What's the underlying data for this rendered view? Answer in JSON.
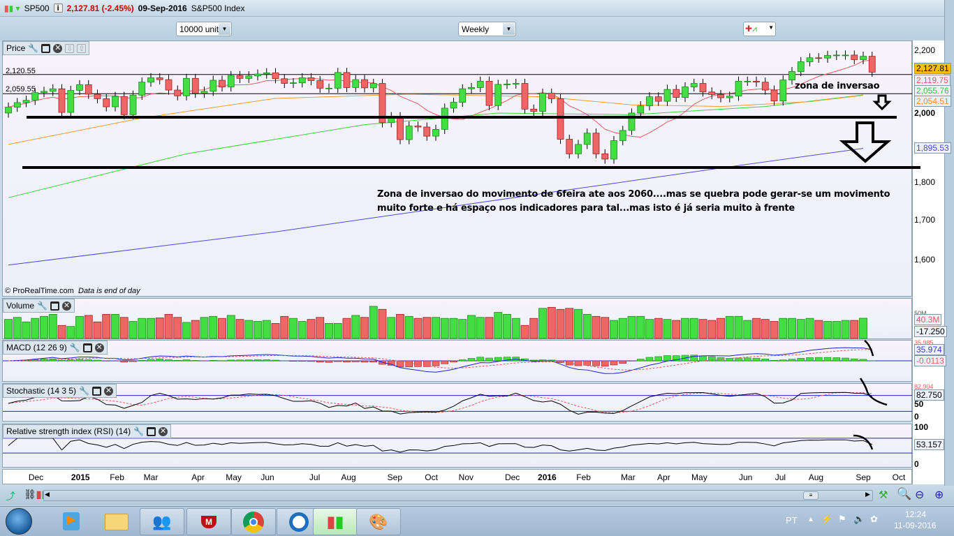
{
  "titlebar": {
    "symbol": "SP500",
    "price_change": "2,127.81 (-2.45%)",
    "date": "09-Sep-2016",
    "name": "S&P500 Index"
  },
  "toolbar": {
    "units": "10000 units",
    "period": "Weekly"
  },
  "price_panel": {
    "title": "Price",
    "hline1": "2,120.55",
    "hline2": "2,059.55",
    "footer": "© ProRealTime.com",
    "footer_note": "Data is end of day",
    "axis": [
      "2,200",
      "2,000",
      "1,800",
      "1,700",
      "1,600"
    ],
    "values": {
      "last": "2,127.81",
      "ma_red": "2,119.75",
      "ma_green": "2,055.76",
      "ma_orange": "2,054.51",
      "ma_blue": "1,895.53"
    }
  },
  "volume_panel": {
    "title": "Volume",
    "axis_top": "50M",
    "last": "40.3M",
    "value2": "-17.250"
  },
  "macd_panel": {
    "title": "MACD (12 26 9)",
    "v_hidden": "35.985",
    "v1": "35.974",
    "v2": "-0.0113"
  },
  "stoch_panel": {
    "title": "Stochastic (14 3 5)",
    "v_hidden": "82.904",
    "v1": "82.750",
    "axis": [
      "50",
      "0"
    ]
  },
  "rsi_panel": {
    "title": "Relative strength index (RSI) (14)",
    "v1": "53.157",
    "axis": [
      "100",
      "0"
    ]
  },
  "annotations": {
    "zone": "zona de inversao",
    "text1": "Zona de inversao do movimento de 6feira ate aos 2060....mas se quebra pode gerar-se um movimento",
    "text2": "muito forte e há espaço nos indicadores para tal...mas isto é já seria muito à frente"
  },
  "colors": {
    "up": "#44dd44",
    "down": "#ee6666",
    "ma_red": "#e06060",
    "ma_orange": "#f0a030",
    "ma_green": "#40d040",
    "ma_blue": "#4a4ae0",
    "last_box": "#f6c000"
  },
  "taskbar": {
    "lang": "PT",
    "time": "12:24",
    "date": "11-09-2016"
  },
  "chart_data": {
    "type": "candlestick",
    "scale": "log",
    "ylim": [
      1550,
      2230
    ],
    "first_open": 2000,
    "close": [
      2018,
      2032,
      2039,
      2063,
      2067,
      2075,
      2002,
      2070,
      2088,
      2058,
      2044,
      2019,
      2051,
      1995,
      2055,
      2096,
      2110,
      2104,
      2071,
      2053,
      2108,
      2061,
      2067,
      2102,
      2081,
      2117,
      2108,
      2116,
      2122,
      2126,
      2107,
      2092,
      2094,
      2110,
      2101,
      2077,
      2077,
      2127,
      2079,
      2104,
      2078,
      2092,
      1971,
      1989,
      1921,
      1961,
      1958,
      1931,
      1951,
      2015,
      2033,
      2075,
      2079,
      2099,
      2023,
      2089,
      2090,
      2092,
      2012,
      2005,
      2061,
      2044,
      1922,
      1880,
      1907,
      1940,
      1880,
      1865,
      1918,
      1948,
      2000,
      2022,
      2050,
      2036,
      2073,
      2048,
      2081,
      2092,
      2065,
      2057,
      2047,
      2052,
      2099,
      2099,
      2096,
      2071,
      2037,
      2103,
      2130,
      2162,
      2175,
      2174,
      2183,
      2184,
      2184,
      2169,
      2180,
      2128
    ],
    "volume": [
      38,
      42,
      33,
      40,
      44,
      48,
      26,
      24,
      44,
      46,
      33,
      48,
      48,
      42,
      34,
      40,
      40,
      41,
      48,
      42,
      32,
      36,
      42,
      44,
      40,
      46,
      38,
      36,
      34,
      36,
      30,
      44,
      40,
      34,
      38,
      42,
      30,
      30,
      40,
      46,
      42,
      64,
      58,
      42,
      48,
      44,
      40,
      42,
      42,
      40,
      40,
      38,
      46,
      42,
      42,
      52,
      48,
      40,
      26,
      40,
      60,
      62,
      58,
      60,
      58,
      48,
      44,
      42,
      36,
      40,
      44,
      44,
      38,
      40,
      38,
      36,
      40,
      40,
      38,
      36,
      40,
      44,
      44,
      36,
      40,
      38,
      34,
      40,
      40,
      38,
      40,
      36,
      34,
      34,
      36,
      36,
      40.3
    ],
    "ma_orange": [
      [
        0,
        1907
      ],
      [
        15,
        1985
      ],
      [
        30,
        2045
      ],
      [
        45,
        2058
      ],
      [
        60,
        2050
      ],
      [
        70,
        2025
      ],
      [
        80,
        2020
      ],
      [
        90,
        2035
      ],
      [
        96,
        2054.51
      ]
    ],
    "ma_green": [
      [
        0,
        1759
      ],
      [
        20,
        1880
      ],
      [
        40,
        1965
      ],
      [
        55,
        2000
      ],
      [
        70,
        1995
      ],
      [
        85,
        2020
      ],
      [
        96,
        2055.76
      ]
    ],
    "ma_blue": [
      [
        0,
        1588
      ],
      [
        30,
        1670
      ],
      [
        60,
        1770
      ],
      [
        80,
        1840
      ],
      [
        96,
        1895.53
      ]
    ],
    "hlines": [
      2120.55,
      2059.55
    ],
    "months": [
      [
        "Dec",
        3.1
      ],
      [
        "2015",
        8.1
      ],
      [
        "Feb",
        12.2
      ],
      [
        "Mar",
        16
      ],
      [
        "Apr",
        21.3
      ],
      [
        "May",
        25.3
      ],
      [
        "Jun",
        29.1
      ],
      [
        "Jul",
        34.4
      ],
      [
        "Aug",
        38.2
      ],
      [
        "Sep",
        43.4
      ],
      [
        "Oct",
        47.5
      ],
      [
        "Nov",
        51.4
      ],
      [
        "Dec",
        56.6
      ],
      [
        "2016",
        60.5
      ],
      [
        "Feb",
        64.6
      ],
      [
        "Mar",
        69.6
      ],
      [
        "Apr",
        73.6
      ],
      [
        "May",
        77.6
      ],
      [
        "Jun",
        82.8
      ],
      [
        "Jul",
        86.7
      ],
      [
        "Aug",
        90.7
      ],
      [
        "Sep",
        96
      ],
      [
        "Oct",
        100
      ]
    ]
  }
}
